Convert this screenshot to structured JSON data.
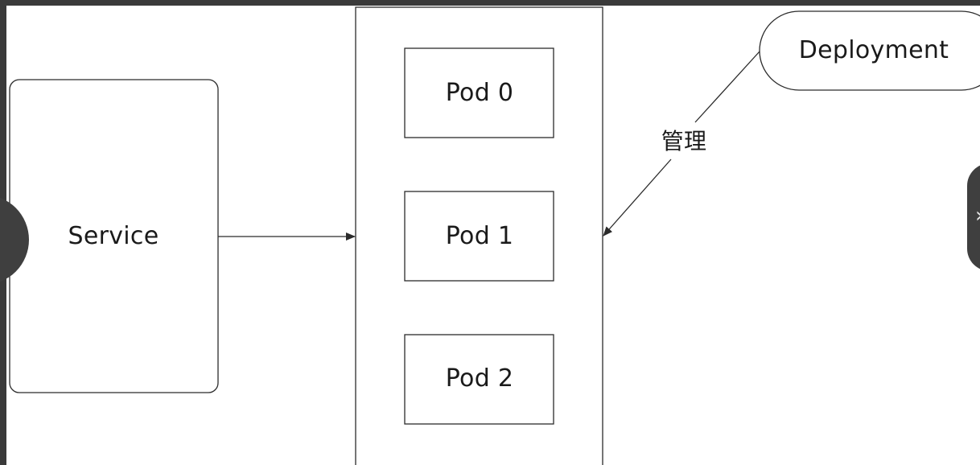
{
  "diagram": {
    "service_label": "Service",
    "pods": [
      {
        "label": "Pod 0"
      },
      {
        "label": "Pod 1"
      },
      {
        "label": "Pod 2"
      }
    ],
    "deployment_label": "Deployment",
    "manage_label": "管理"
  },
  "colors": {
    "background": "#ffffff",
    "stroke": "#2b2b2b",
    "frame": "#3a3a3a",
    "nav": "#3f3f3f"
  },
  "icons": {
    "prev": "chevron-left-icon",
    "next": "chevron-right-icon"
  }
}
